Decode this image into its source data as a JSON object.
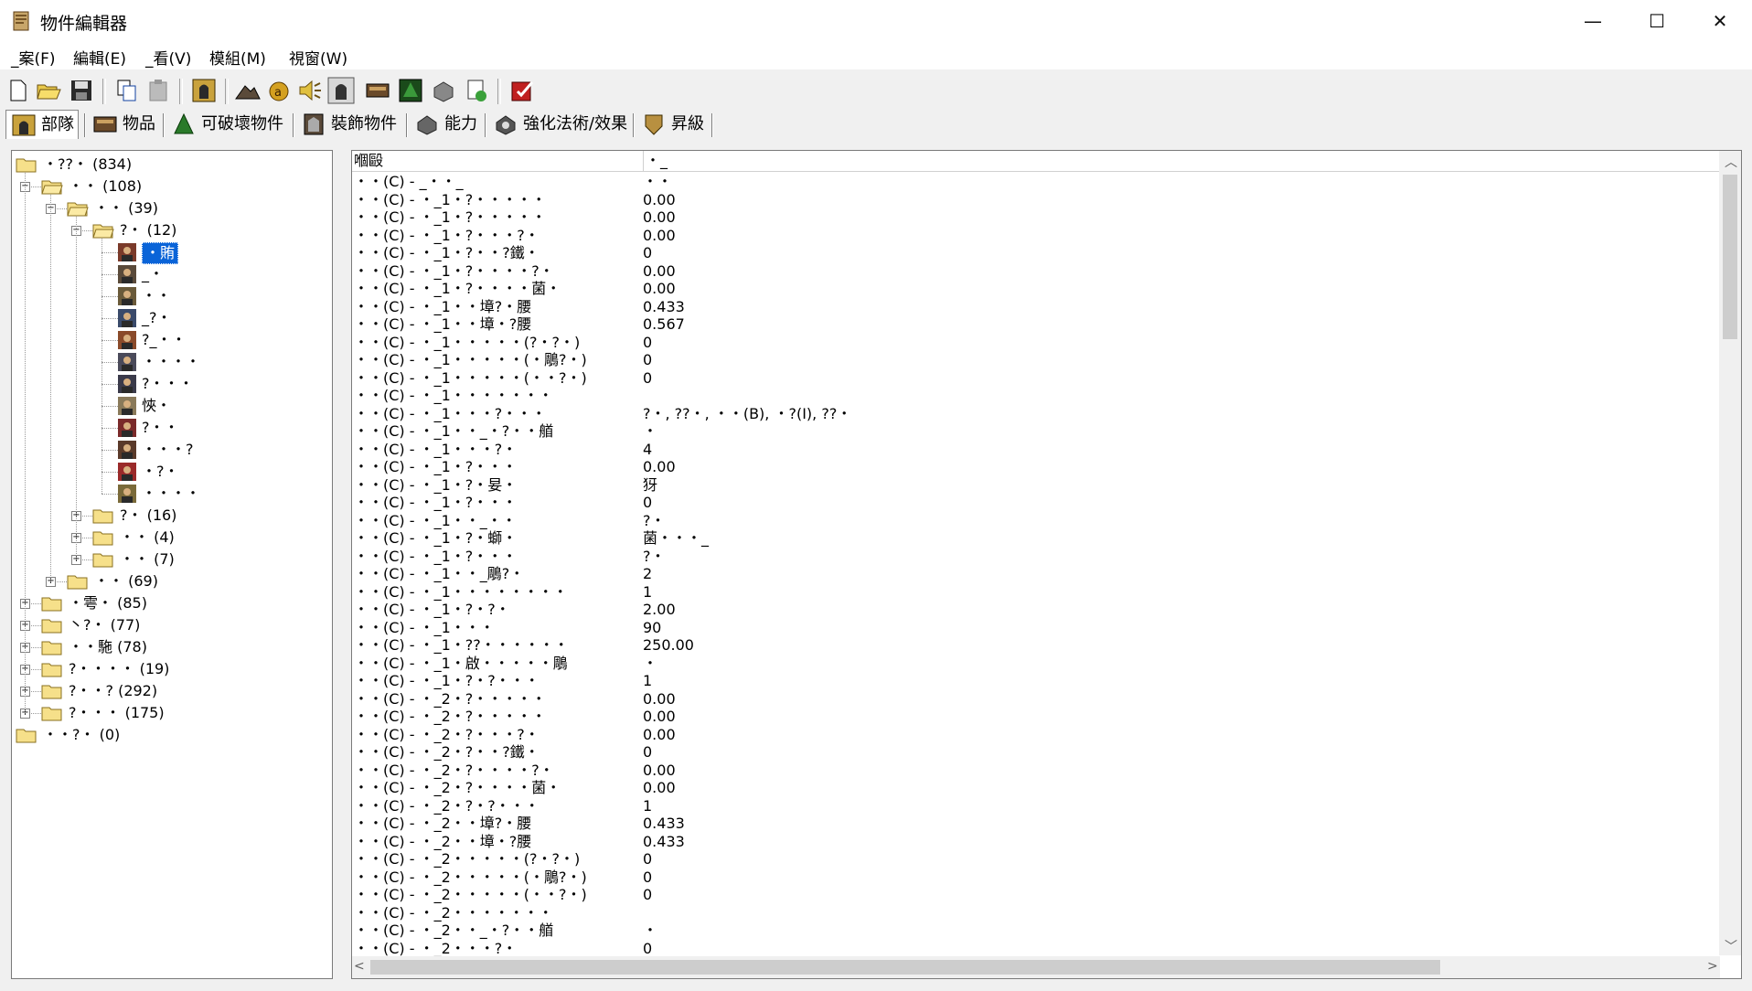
{
  "window": {
    "title": "物件編輯器",
    "minimize_glyph": "—",
    "maximize_glyph": "☐",
    "close_glyph": "✕"
  },
  "menu": [
    "_案(F)",
    "編輯(E)",
    "_看(V)",
    "模組(M)",
    "視窗(W)"
  ],
  "toolbar": {
    "buttons": [
      "new-icon",
      "open-icon",
      "save-icon",
      "copy-icon",
      "paste-icon",
      "units-icon",
      "terrain-icon",
      "gold-icon",
      "sound-icon",
      "unit-editor-icon",
      "item-editor-icon",
      "doodad-editor-icon",
      "ability-editor-icon",
      "buff-editor-icon",
      "upgrade-editor-icon",
      "test-map-icon"
    ]
  },
  "tabs": [
    {
      "label": "部隊",
      "icon": "unit-tab-icon",
      "active": true
    },
    {
      "label": "物品",
      "icon": "item-tab-icon",
      "active": false
    },
    {
      "label": "可破壞物件",
      "icon": "destructible-tab-icon",
      "active": false
    },
    {
      "label": "裝飾物件",
      "icon": "doodad-tab-icon",
      "active": false
    },
    {
      "label": "能力",
      "icon": "ability-tab-icon",
      "active": false
    },
    {
      "label": "強化法術/效果",
      "icon": "buff-tab-icon",
      "active": false
    },
    {
      "label": "昇級",
      "icon": "upgrade-tab-icon",
      "active": false
    }
  ],
  "tree": [
    {
      "label": "・??・ (834)",
      "depth": 0,
      "type": "folder",
      "expander": "none"
    },
    {
      "label": "・・ (108)",
      "depth": 1,
      "type": "folder",
      "expander": "minus"
    },
    {
      "label": "・・ (39)",
      "depth": 2,
      "type": "folder",
      "expander": "minus"
    },
    {
      "label": "?・ (12)",
      "depth": 3,
      "type": "folder",
      "expander": "minus"
    },
    {
      "label": "・賄",
      "depth": 4,
      "type": "unit",
      "selected": true
    },
    {
      "label": "_・",
      "depth": 4,
      "type": "unit"
    },
    {
      "label": "・・",
      "depth": 4,
      "type": "unit"
    },
    {
      "label": "_?・",
      "depth": 4,
      "type": "unit"
    },
    {
      "label": "?_・・",
      "depth": 4,
      "type": "unit"
    },
    {
      "label": "・・・・",
      "depth": 4,
      "type": "unit"
    },
    {
      "label": "?・・・",
      "depth": 4,
      "type": "unit"
    },
    {
      "label": "悏・",
      "depth": 4,
      "type": "unit"
    },
    {
      "label": "?・・",
      "depth": 4,
      "type": "unit"
    },
    {
      "label": "・・・?",
      "depth": 4,
      "type": "unit"
    },
    {
      "label": "・?・",
      "depth": 4,
      "type": "unit"
    },
    {
      "label": "・・・・",
      "depth": 4,
      "type": "unit"
    },
    {
      "label": "?・ (16)",
      "depth": 3,
      "type": "folder",
      "expander": "plus"
    },
    {
      "label": "・・ (4)",
      "depth": 3,
      "type": "folder",
      "expander": "plus"
    },
    {
      "label": "・・ (7)",
      "depth": 3,
      "type": "folder",
      "expander": "plus"
    },
    {
      "label": "・・ (69)",
      "depth": 2,
      "type": "folder",
      "expander": "plus"
    },
    {
      "label": "・雩・ (85)",
      "depth": 1,
      "type": "folder",
      "expander": "plus"
    },
    {
      "label": "丶?・ (77)",
      "depth": 1,
      "type": "folder",
      "expander": "plus"
    },
    {
      "label": "・・駞 (78)",
      "depth": 1,
      "type": "folder",
      "expander": "plus"
    },
    {
      "label": "?・・・・ (19)",
      "depth": 1,
      "type": "folder",
      "expander": "plus"
    },
    {
      "label": "?・・? (292)",
      "depth": 1,
      "type": "folder",
      "expander": "plus"
    },
    {
      "label": "?・・・ (175)",
      "depth": 1,
      "type": "folder",
      "expander": "plus"
    },
    {
      "label": "・・?・ (0)",
      "depth": 0,
      "type": "folder",
      "expander": "none"
    }
  ],
  "list": {
    "headers": [
      "嗰毆",
      "・_"
    ],
    "rows": [
      [
        "・・(C) - _・・_",
        "・・"
      ],
      [
        "・・(C) - ・_1・?・・・・・",
        "0.00"
      ],
      [
        "・・(C) - ・_1・?・・・・・",
        "0.00"
      ],
      [
        "・・(C) - ・_1・?・・・?・",
        "0.00"
      ],
      [
        "・・(C) - ・_1・?・・?鐵・",
        "0"
      ],
      [
        "・・(C) - ・_1・?・・・・?・",
        "0.00"
      ],
      [
        "・・(C) - ・_1・?・・・・菌・",
        "0.00"
      ],
      [
        "・・(C) - ・_1・・墇?・腰",
        "0.433"
      ],
      [
        "・・(C) - ・_1・・墇・?腰",
        "0.567"
      ],
      [
        "・・(C) - ・_1・・・・・(?・?・)",
        "0"
      ],
      [
        "・・(C) - ・_1・・・・・(・鵰?・)",
        "0"
      ],
      [
        "・・(C) - ・_1・・・・・(・・?・)",
        "0"
      ],
      [
        "・・(C) - ・_1・・・・・・・",
        ""
      ],
      [
        "・・(C) - ・_1・・・?・・・",
        "?・, ??・, ・・(B), ・?(I), ??・"
      ],
      [
        "・・(C) - ・_1・・_・?・・艏",
        "・"
      ],
      [
        "・・(C) - ・_1・・・?・",
        "4"
      ],
      [
        "・・(C) - ・_1・?・・・",
        "0.00"
      ],
      [
        "・・(C) - ・_1・?・妟・",
        "犽"
      ],
      [
        "・・(C) - ・_1・?・・・",
        "0"
      ],
      [
        "・・(C) - ・_1・・_・・",
        "?・"
      ],
      [
        "・・(C) - ・_1・?・螄・",
        "菌・・・_"
      ],
      [
        "・・(C) - ・_1・?・・・",
        "?・"
      ],
      [
        "・・(C) - ・_1・・_鵰?・",
        "2"
      ],
      [
        "・・(C) - ・_1・・・・・・・・",
        "1"
      ],
      [
        "・・(C) - ・_1・?・?・",
        "2.00"
      ],
      [
        "・・(C) - ・_1・・・",
        "90"
      ],
      [
        "・・(C) - ・_1・??・・・・・・",
        "250.00"
      ],
      [
        "・・(C) - ・_1・啟・・・・・鵰",
        "・"
      ],
      [
        "・・(C) - ・_1・?・?・・・",
        "1"
      ],
      [
        "・・(C) - ・_2・?・・・・・",
        "0.00"
      ],
      [
        "・・(C) - ・_2・?・・・・・",
        "0.00"
      ],
      [
        "・・(C) - ・_2・?・・・?・",
        "0.00"
      ],
      [
        "・・(C) - ・_2・?・・?鐵・",
        "0"
      ],
      [
        "・・(C) - ・_2・?・・・・?・",
        "0.00"
      ],
      [
        "・・(C) - ・_2・?・・・・菌・",
        "0.00"
      ],
      [
        "・・(C) - ・_2・?・?・・・",
        "1"
      ],
      [
        "・・(C) - ・_2・・墇?・腰",
        "0.433"
      ],
      [
        "・・(C) - ・_2・・墇・?腰",
        "0.433"
      ],
      [
        "・・(C) - ・_2・・・・・(?・?・)",
        "0"
      ],
      [
        "・・(C) - ・_2・・・・・(・鵰?・)",
        "0"
      ],
      [
        "・・(C) - ・_2・・・・・(・・?・)",
        "0"
      ],
      [
        "・・(C) - ・_2・・・・・・・",
        ""
      ],
      [
        "・・(C) - ・_2・・_・?・・艏",
        "・"
      ],
      [
        "・・(C) - ・_2・・・?・",
        "0"
      ]
    ]
  }
}
